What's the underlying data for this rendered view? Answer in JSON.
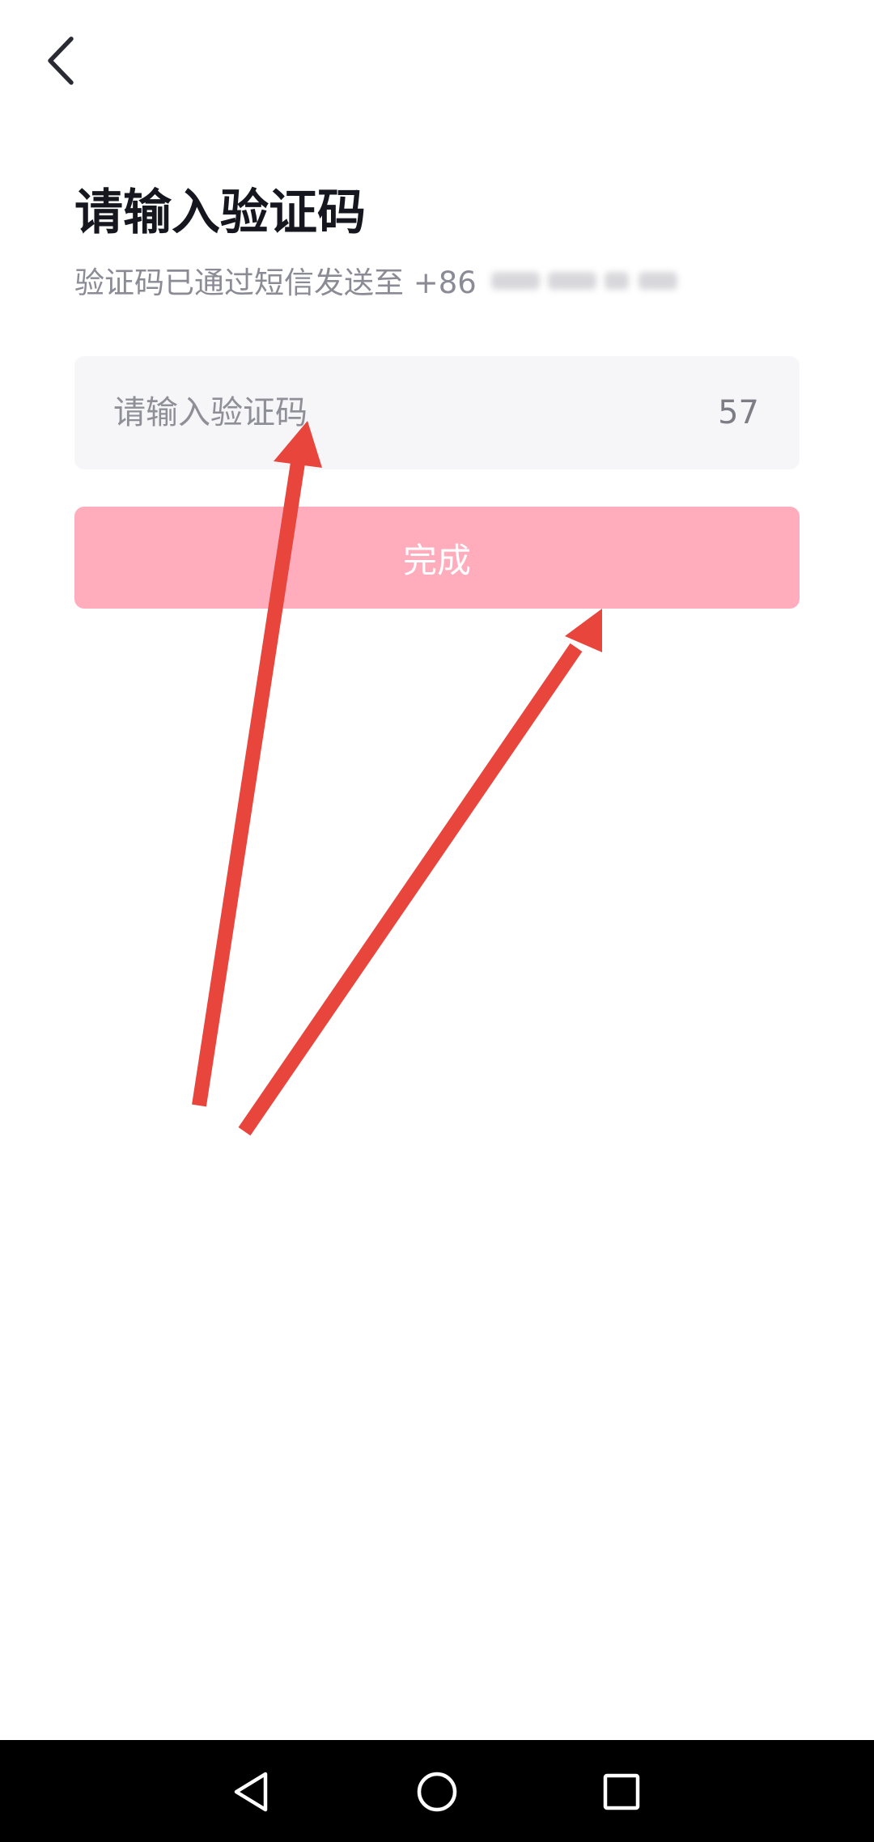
{
  "header": {
    "back_icon": "chevron-left-icon"
  },
  "title": "请输入验证码",
  "subtitle": {
    "text": "验证码已通过短信发送至 +86",
    "phone_masked": true
  },
  "code_input": {
    "placeholder": "请输入验证码",
    "value": "",
    "countdown": "57"
  },
  "submit": {
    "label": "完成",
    "enabled": false
  },
  "annotations": {
    "arrow_color": "#e8453c",
    "count": 2
  },
  "nav_bar": {
    "back_icon": "triangle-back-icon",
    "home_icon": "circle-home-icon",
    "recents_icon": "square-recents-icon"
  },
  "colors": {
    "title": "#16161f",
    "subtitle": "#8b8b95",
    "input_bg": "#f6f6f8",
    "button_disabled": "#ffadbd",
    "nav_bar_bg": "#000000"
  }
}
